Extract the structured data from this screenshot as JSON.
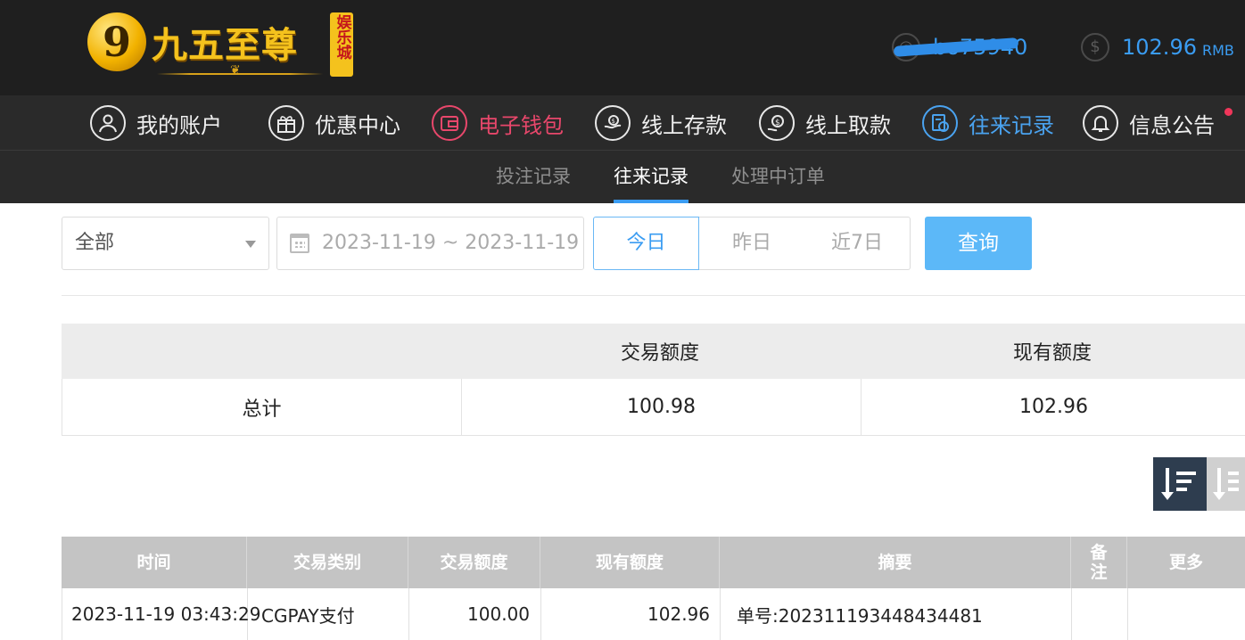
{
  "header": {
    "logo": {
      "badge": "9",
      "title": "九五至尊",
      "tag": "娱乐城"
    },
    "username": "bo75940",
    "balance": "102.96",
    "balance_unit": "RMB"
  },
  "main_nav": [
    {
      "label": "我的账户",
      "icon": "user-icon"
    },
    {
      "label": "优惠中心",
      "icon": "gift-icon"
    },
    {
      "label": "电子钱包",
      "icon": "wallet-icon"
    },
    {
      "label": "线上存款",
      "icon": "deposit-icon"
    },
    {
      "label": "线上取款",
      "icon": "withdraw-icon"
    },
    {
      "label": "往来记录",
      "icon": "records-icon"
    },
    {
      "label": "信息公告",
      "icon": "bell-icon"
    }
  ],
  "sub_nav": [
    {
      "label": "投注记录"
    },
    {
      "label": "往来记录",
      "active": true
    },
    {
      "label": "处理中订单"
    }
  ],
  "filters": {
    "type_select": "全部",
    "date_range": "2023-11-19 ~ 2023-11-19",
    "quick": [
      "今日",
      "昨日",
      "近7日"
    ],
    "search_label": "查询"
  },
  "summary": {
    "headers": [
      "",
      "交易额度",
      "现有额度"
    ],
    "row": {
      "label": "总计",
      "amount": "100.98",
      "balance": "102.96"
    }
  },
  "records": {
    "headers": [
      "时间",
      "交易类别",
      "交易额度",
      "现有额度",
      "摘要",
      "备注",
      "更多"
    ],
    "rows": [
      {
        "time": "2023-11-19 03:43:29",
        "type": "CGPAY支付",
        "amount": "100.00",
        "balance": "102.96",
        "summary": "单号:202311193448434481",
        "note": "",
        "more": ""
      }
    ]
  },
  "colors": {
    "accent_blue": "#3a9cf2",
    "accent_red": "#e8476b",
    "header_bg": "#1f1f1f",
    "nav_bg": "#2a2a2a",
    "search_button": "#5cb8f8"
  }
}
